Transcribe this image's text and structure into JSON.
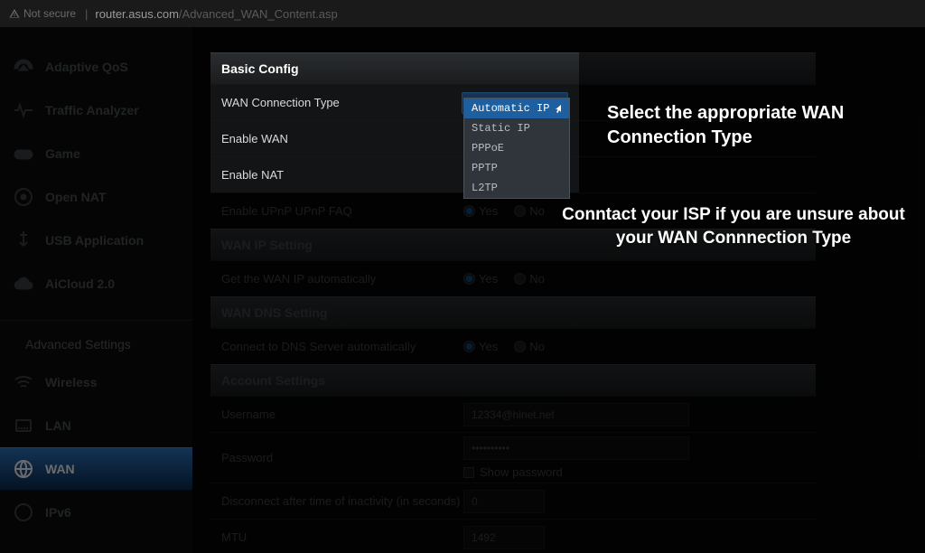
{
  "urlbar": {
    "warn": "Not secure",
    "domain": "router.asus.com",
    "path": "/Advanced_WAN_Content.asp"
  },
  "sidebar": {
    "items": [
      {
        "name": "adaptive-qos",
        "label": "Adaptive QoS",
        "icon": "gauge"
      },
      {
        "name": "traffic-analyzer",
        "label": "Traffic Analyzer",
        "icon": "pulse"
      },
      {
        "name": "game",
        "label": "Game",
        "icon": "gamepad"
      },
      {
        "name": "open-nat",
        "label": "Open NAT",
        "icon": "globe-gear"
      },
      {
        "name": "usb-application",
        "label": "USB Application",
        "icon": "usb"
      },
      {
        "name": "aicloud",
        "label": "AiCloud 2.0",
        "icon": "cloud"
      }
    ],
    "advanced_label": "Advanced Settings",
    "advanced": [
      {
        "name": "wireless",
        "label": "Wireless",
        "icon": "wifi"
      },
      {
        "name": "lan",
        "label": "LAN",
        "icon": "ethernet"
      },
      {
        "name": "wan",
        "label": "WAN",
        "icon": "globe",
        "active": true
      },
      {
        "name": "ipv6",
        "label": "IPv6",
        "icon": "ipv6"
      }
    ]
  },
  "panel": {
    "basic_header": "Basic Config",
    "rows": {
      "wan_conn_type_label": "WAN Connection Type",
      "wan_conn_type_value": "PPPoE",
      "wan_conn_type_options": [
        "Automatic IP",
        "Static IP",
        "PPPoE",
        "PPTP",
        "L2TP"
      ],
      "enable_wan_label": "Enable WAN",
      "enable_nat_label": "Enable NAT",
      "enable_upnp_label": "Enable UPnP",
      "upnp_faq": "UPnP FAQ",
      "yes": "Yes",
      "no": "No"
    },
    "wan_ip_header": "WAN IP Setting",
    "wan_ip_auto_label": "Get the WAN IP automatically",
    "wan_dns_header": "WAN DNS Setting",
    "wan_dns_auto_label": "Connect to DNS Server automatically",
    "account_header": "Account Settings",
    "username_label": "Username",
    "username_value": "12334@hinet.net",
    "password_label": "Password",
    "password_value": "••••••••••",
    "show_password_label": "Show password",
    "disconnect_label": "Disconnect after time of inactivity (in seconds)",
    "disconnect_value": "0",
    "mtu_label": "MTU",
    "mtu_value": "1492"
  },
  "annotations": {
    "a1": "Select the appropriate WAN Connection Type",
    "a2": "Conntact your ISP if you are unsure about your WAN Connnection Type"
  }
}
